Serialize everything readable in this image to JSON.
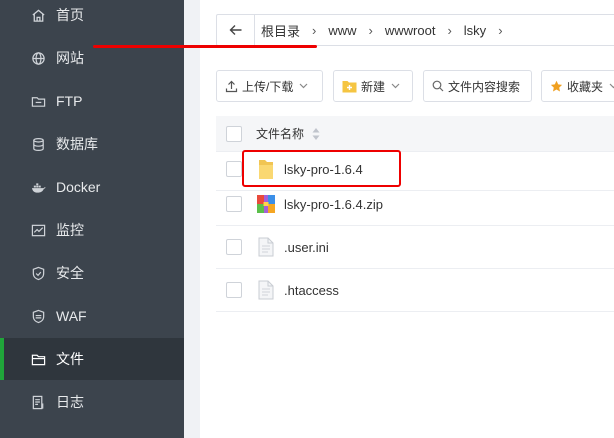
{
  "sidebar": {
    "items": [
      {
        "label": "首页",
        "icon": "home-icon"
      },
      {
        "label": "网站",
        "icon": "globe-icon"
      },
      {
        "label": "FTP",
        "icon": "ftp-folder-icon"
      },
      {
        "label": "数据库",
        "icon": "database-icon"
      },
      {
        "label": "Docker",
        "icon": "docker-icon"
      },
      {
        "label": "监控",
        "icon": "monitor-icon"
      },
      {
        "label": "安全",
        "icon": "shield-icon"
      },
      {
        "label": "WAF",
        "icon": "waf-shield-icon"
      },
      {
        "label": "文件",
        "icon": "folder-icon",
        "active": true
      },
      {
        "label": "日志",
        "icon": "log-icon"
      }
    ]
  },
  "breadcrumb": {
    "back_icon": "arrow-left-icon",
    "segments": [
      "根目录",
      "www",
      "wwwroot",
      "lsky"
    ]
  },
  "toolbar": {
    "upload_download": "上传/下载",
    "new": "新建",
    "search_content": "文件内容搜索",
    "favorites": "收藏夹"
  },
  "table": {
    "header_name": "文件名称",
    "rows": [
      {
        "name": "lsky-pro-1.6.4",
        "type": "folder"
      },
      {
        "name": "lsky-pro-1.6.4.zip",
        "type": "zip"
      },
      {
        "name": ".user.ini",
        "type": "file"
      },
      {
        "name": ".htaccess",
        "type": "file"
      }
    ]
  },
  "colors": {
    "sidebar_bg": "#3c444d",
    "active_accent": "#20a53a",
    "annotation_red": "#e00000"
  }
}
